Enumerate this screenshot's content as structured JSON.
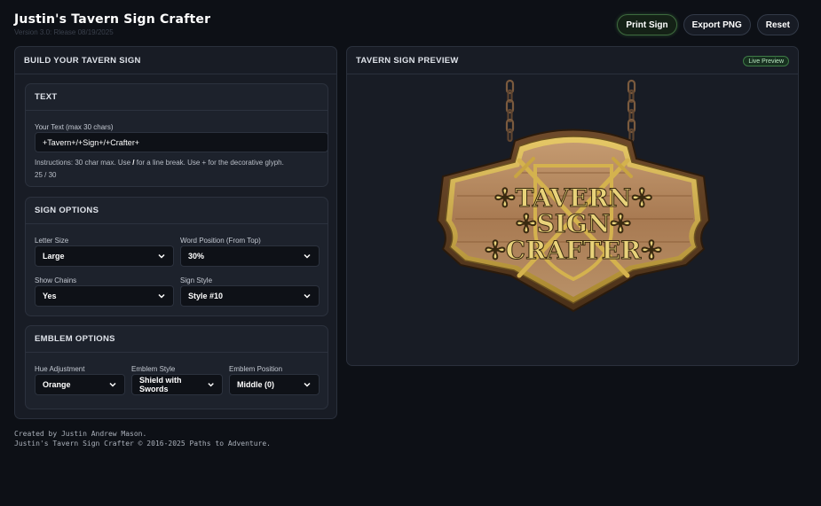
{
  "app": {
    "title": "Justin's Tavern Sign Crafter",
    "version": "Version 3.0: Rlease 08/19/2025"
  },
  "header_buttons": {
    "print": "Print Sign",
    "export": "Export PNG",
    "reset": "Reset"
  },
  "build_panel": {
    "title": "BUILD YOUR TAVERN SIGN",
    "text_section": {
      "title": "TEXT",
      "input_label": "Your Text (max 30 chars)",
      "input_value": "+Tavern+/+Sign+/+Crafter+",
      "instructions_prefix": "Instructions: 30 char max. Use ",
      "instructions_slash": "/",
      "instructions_suffix": " for a line break. Use + for the decorative glyph.",
      "counter": "25 / 30"
    },
    "sign_options": {
      "title": "SIGN OPTIONS",
      "letter_size": {
        "label": "Letter Size",
        "value": "Large"
      },
      "word_position": {
        "label": "Word Position (From Top)",
        "value": "30%"
      },
      "show_chains": {
        "label": "Show Chains",
        "value": "Yes"
      },
      "sign_style": {
        "label": "Sign Style",
        "value": "Style #10"
      }
    },
    "emblem_options": {
      "title": "EMBLEM OPTIONS",
      "hue": {
        "label": "Hue Adjustment",
        "value": "Orange"
      },
      "emblem_style": {
        "label": "Emblem Style",
        "value": "Shield with Swords"
      },
      "emblem_position": {
        "label": "Emblem Position",
        "value": "Middle (0)"
      }
    }
  },
  "preview_panel": {
    "title": "TAVERN SIGN PREVIEW",
    "badge": "Live Preview",
    "sign_lines": [
      "✢TAVERN✢",
      "✢SIGN✢",
      "✢CRAFTER✢"
    ]
  },
  "footer": {
    "line1": "Created by Justin Andrew Mason.",
    "line2": "Justin's Tavern Sign Crafter © 2016-2025 Paths to Adventure."
  },
  "colors": {
    "background": "#0d1016",
    "panel": "#181c25",
    "accent_green": "#3d7a45",
    "gold": "#c9a542",
    "wood": "#b89067"
  }
}
